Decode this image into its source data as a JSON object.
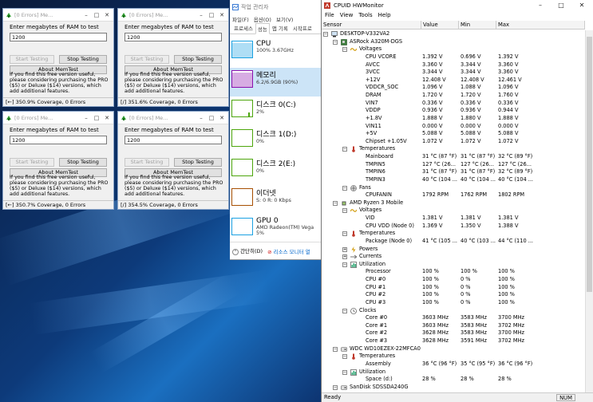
{
  "memtest": {
    "title": "[0 Errors] Me...",
    "prompt": "Enter megabytes of RAM to test",
    "start_label": "Start Testing",
    "stop_label": "Stop Testing",
    "about_label": "About MemTest",
    "info": "If you find this free version useful, please considering purchasing the PRO ($5) or Deluxe ($14) versions, which add additional features.",
    "windows": [
      {
        "value": "1200",
        "status": "[←]   350.9% Coverage, 0 Errors"
      },
      {
        "value": "1200",
        "status": "[/]   351.6% Coverage, 0 Errors"
      },
      {
        "value": "1200",
        "status": "[←]   350.7% Coverage, 0 Errors"
      },
      {
        "value": "1200",
        "status": "[/]   354.5% Coverage, 0 Errors"
      }
    ]
  },
  "taskmgr": {
    "title": "작업 관리자",
    "menu": [
      "파일(F)",
      "옵션(O)",
      "보기(V)"
    ],
    "tabs": [
      "프로세스",
      "성능",
      "앱 기록",
      "시작프로"
    ],
    "items": [
      {
        "name": "CPU",
        "value": "100% 3.67GHz",
        "color": "#1ba1e2"
      },
      {
        "name": "메모리",
        "value": "6.2/6.9GB (90%)",
        "color": "#8b12ae"
      },
      {
        "name": "디스크 0(C:)",
        "value": "2%",
        "color": "#4da60c"
      },
      {
        "name": "디스크 1(D:)",
        "value": "0%",
        "color": "#4da60c"
      },
      {
        "name": "디스크 2(E:)",
        "value": "0%",
        "color": "#4da60c"
      },
      {
        "name": "이더넷",
        "value": "S: 0  R: 0 Kbps",
        "color": "#a74f01"
      },
      {
        "name": "GPU 0",
        "value": "AMD Radeon(TM) Vega",
        "value2": "5%",
        "color": "#1ba1e2"
      }
    ],
    "fewer_details": "간단히(D)",
    "resource_monitor": "리소스 모니터 열"
  },
  "hwmon": {
    "title": "CPUID HWMonitor",
    "menu": [
      "File",
      "View",
      "Tools",
      "Help"
    ],
    "columns": [
      "Sensor",
      "Value",
      "Min",
      "Max"
    ],
    "status": "Ready",
    "num": "NUM",
    "rows": [
      {
        "d": 0,
        "t": "root",
        "n": "DESKTOP-V332VA2",
        "ic": "pc"
      },
      {
        "d": 1,
        "t": "dev",
        "n": "ASRock A320M-DGS",
        "ic": "mb"
      },
      {
        "d": 2,
        "t": "cat",
        "n": "Voltages",
        "ic": "volt"
      },
      {
        "d": 3,
        "n": "CPU VCORE",
        "v": "1.392 V",
        "mn": "0.696 V",
        "mx": "1.392 V"
      },
      {
        "d": 3,
        "n": "AVCC",
        "v": "3.360 V",
        "mn": "3.344 V",
        "mx": "3.360 V"
      },
      {
        "d": 3,
        "n": "3VCC",
        "v": "3.344 V",
        "mn": "3.344 V",
        "mx": "3.360 V"
      },
      {
        "d": 3,
        "n": "+12V",
        "v": "12.408 V",
        "mn": "12.408 V",
        "mx": "12.461 V"
      },
      {
        "d": 3,
        "n": "VDDCR_SOC",
        "v": "1.096 V",
        "mn": "1.088 V",
        "mx": "1.096 V"
      },
      {
        "d": 3,
        "n": "DRAM",
        "v": "1.720 V",
        "mn": "1.720 V",
        "mx": "1.760 V"
      },
      {
        "d": 3,
        "n": "VIN7",
        "v": "0.336 V",
        "mn": "0.336 V",
        "mx": "0.336 V"
      },
      {
        "d": 3,
        "n": "VDDP",
        "v": "0.936 V",
        "mn": "0.936 V",
        "mx": "0.944 V"
      },
      {
        "d": 3,
        "n": "+1.8V",
        "v": "1.888 V",
        "mn": "1.880 V",
        "mx": "1.888 V"
      },
      {
        "d": 3,
        "n": "VIN11",
        "v": "0.000 V",
        "mn": "0.000 V",
        "mx": "0.000 V"
      },
      {
        "d": 3,
        "n": "+5V",
        "v": "5.088 V",
        "mn": "5.088 V",
        "mx": "5.088 V"
      },
      {
        "d": 3,
        "n": "Chipset +1.05V",
        "v": "1.072 V",
        "mn": "1.072 V",
        "mx": "1.072 V"
      },
      {
        "d": 2,
        "t": "cat",
        "n": "Temperatures",
        "ic": "temp"
      },
      {
        "d": 3,
        "n": "Mainboard",
        "v": "31 °C  (87 °F)",
        "mn": "31 °C  (87 °F)",
        "mx": "32 °C  (89 °F)"
      },
      {
        "d": 3,
        "n": "TMPIN5",
        "v": "127 °C  (26...",
        "mn": "127 °C  (26...",
        "mx": "127 °C  (26..."
      },
      {
        "d": 3,
        "n": "TMPIN6",
        "v": "31 °C  (87 °F)",
        "mn": "31 °C  (87 °F)",
        "mx": "32 °C  (89 °F)"
      },
      {
        "d": 3,
        "n": "TMPIN3",
        "v": "40 °C  (104 ...",
        "mn": "40 °C  (104 ...",
        "mx": "40 °C  (104 ..."
      },
      {
        "d": 2,
        "t": "cat",
        "n": "Fans",
        "ic": "fan"
      },
      {
        "d": 3,
        "n": "CPUFANIN",
        "v": "1792 RPM",
        "mn": "1762 RPM",
        "mx": "1802 RPM"
      },
      {
        "d": 1,
        "t": "dev",
        "n": "AMD Ryzen 3 Mobile",
        "ic": "cpu"
      },
      {
        "d": 2,
        "t": "cat",
        "n": "Voltages",
        "ic": "volt"
      },
      {
        "d": 3,
        "n": "VID",
        "v": "1.381 V",
        "mn": "1.381 V",
        "mx": "1.381 V"
      },
      {
        "d": 3,
        "n": "CPU VDD (Node 0)",
        "v": "1.369 V",
        "mn": "1.350 V",
        "mx": "1.388 V"
      },
      {
        "d": 2,
        "t": "cat",
        "n": "Temperatures",
        "ic": "temp"
      },
      {
        "d": 3,
        "n": "Package (Node 0)",
        "v": "41 °C  (105 ...",
        "mn": "40 °C  (103 ...",
        "mx": "44 °C  (110 ..."
      },
      {
        "d": 2,
        "t": "cat",
        "n": "Powers",
        "ic": "power",
        "collapsed": true
      },
      {
        "d": 2,
        "t": "cat",
        "n": "Currents",
        "ic": "current",
        "collapsed": true
      },
      {
        "d": 2,
        "t": "cat",
        "n": "Utilization",
        "ic": "util"
      },
      {
        "d": 3,
        "n": "Processor",
        "v": "100 %",
        "mn": "100 %",
        "mx": "100 %"
      },
      {
        "d": 3,
        "n": "CPU #0",
        "v": "100 %",
        "mn": "0 %",
        "mx": "100 %"
      },
      {
        "d": 3,
        "n": "CPU #1",
        "v": "100 %",
        "mn": "0 %",
        "mx": "100 %"
      },
      {
        "d": 3,
        "n": "CPU #2",
        "v": "100 %",
        "mn": "0 %",
        "mx": "100 %"
      },
      {
        "d": 3,
        "n": "CPU #3",
        "v": "100 %",
        "mn": "0 %",
        "mx": "100 %"
      },
      {
        "d": 2,
        "t": "cat",
        "n": "Clocks",
        "ic": "clock"
      },
      {
        "d": 3,
        "n": "Core #0",
        "v": "3603 MHz",
        "mn": "3583 MHz",
        "mx": "3700 MHz"
      },
      {
        "d": 3,
        "n": "Core #1",
        "v": "3603 MHz",
        "mn": "3583 MHz",
        "mx": "3702 MHz"
      },
      {
        "d": 3,
        "n": "Core #2",
        "v": "3628 MHz",
        "mn": "3583 MHz",
        "mx": "3700 MHz"
      },
      {
        "d": 3,
        "n": "Core #3",
        "v": "3628 MHz",
        "mn": "3591 MHz",
        "mx": "3702 MHz"
      },
      {
        "d": 1,
        "t": "dev",
        "n": "WDC WD10EZEX-22MFCA0",
        "ic": "hdd"
      },
      {
        "d": 2,
        "t": "cat",
        "n": "Temperatures",
        "ic": "temp"
      },
      {
        "d": 3,
        "n": "Assembly",
        "v": "36 °C  (96 °F)",
        "mn": "35 °C  (95 °F)",
        "mx": "36 °C  (96 °F)"
      },
      {
        "d": 2,
        "t": "cat",
        "n": "Utilization",
        "ic": "util"
      },
      {
        "d": 3,
        "n": "Space (d:)",
        "v": "28 %",
        "mn": "28 %",
        "mx": "28 %"
      },
      {
        "d": 1,
        "t": "dev",
        "n": "SanDisk SDSSDA240G",
        "ic": "hdd"
      }
    ]
  }
}
